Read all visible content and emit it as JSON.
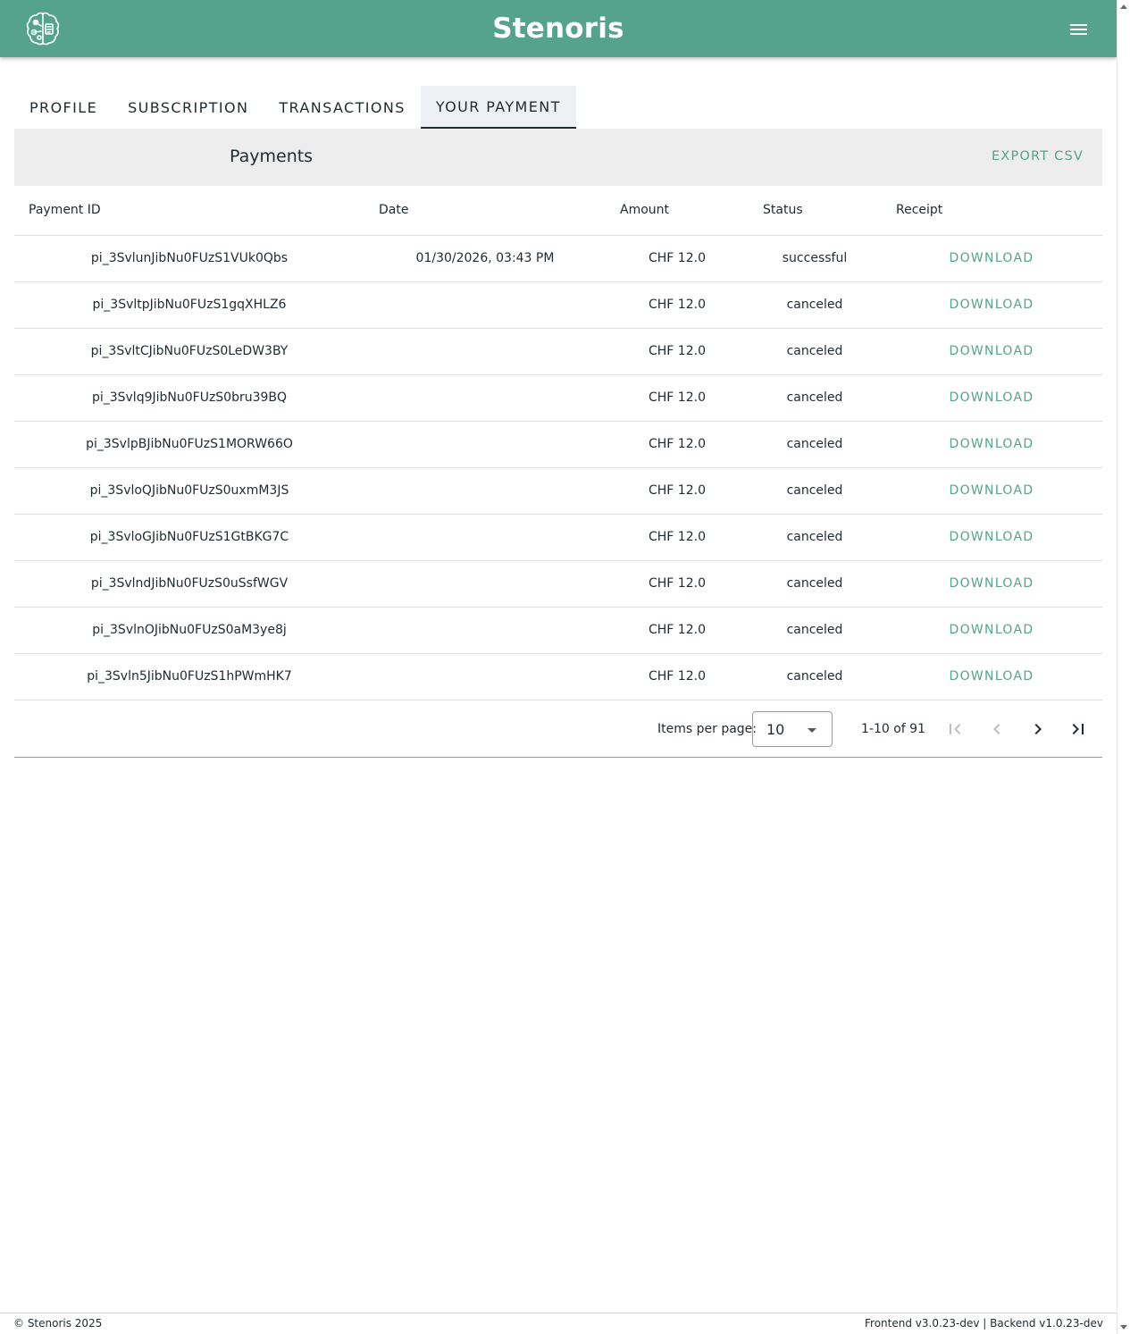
{
  "header": {
    "title": "Stenoris",
    "logo_icon": "brain-circuit-logo-icon",
    "menu_icon": "hamburger-menu-icon",
    "color": "#54a38a"
  },
  "tabs": [
    {
      "label": "PROFILE",
      "active": false
    },
    {
      "label": "SUBSCRIPTION",
      "active": false
    },
    {
      "label": "TRANSACTIONS",
      "active": false
    },
    {
      "label": "YOUR PAYMENT",
      "active": true
    }
  ],
  "payments": {
    "title": "Payments",
    "export_label": "EXPORT CSV",
    "columns": [
      "Payment ID",
      "Date",
      "Amount",
      "Status",
      "Receipt"
    ],
    "rows": [
      {
        "id": "pi_3SvlunJibNu0FUzS1VUk0Qbs",
        "date": "01/30/2026, 03:43 PM",
        "amount": "CHF 12.0",
        "status": "successful",
        "receipt": "DOWNLOAD"
      },
      {
        "id": "pi_3SvltpJibNu0FUzS1gqXHLZ6",
        "date": "",
        "amount": "CHF 12.0",
        "status": "canceled",
        "receipt": "DOWNLOAD"
      },
      {
        "id": "pi_3SvltCJibNu0FUzS0LeDW3BY",
        "date": "",
        "amount": "CHF 12.0",
        "status": "canceled",
        "receipt": "DOWNLOAD"
      },
      {
        "id": "pi_3Svlq9JibNu0FUzS0bru39BQ",
        "date": "",
        "amount": "CHF 12.0",
        "status": "canceled",
        "receipt": "DOWNLOAD"
      },
      {
        "id": "pi_3SvlpBJibNu0FUzS1MORW66O",
        "date": "",
        "amount": "CHF 12.0",
        "status": "canceled",
        "receipt": "DOWNLOAD"
      },
      {
        "id": "pi_3SvloQJibNu0FUzS0uxmM3JS",
        "date": "",
        "amount": "CHF 12.0",
        "status": "canceled",
        "receipt": "DOWNLOAD"
      },
      {
        "id": "pi_3SvloGJibNu0FUzS1GtBKG7C",
        "date": "",
        "amount": "CHF 12.0",
        "status": "canceled",
        "receipt": "DOWNLOAD"
      },
      {
        "id": "pi_3SvlndJibNu0FUzS0uSsfWGV",
        "date": "",
        "amount": "CHF 12.0",
        "status": "canceled",
        "receipt": "DOWNLOAD"
      },
      {
        "id": "pi_3SvlnOJibNu0FUzS0aM3ye8j",
        "date": "",
        "amount": "CHF 12.0",
        "status": "canceled",
        "receipt": "DOWNLOAD"
      },
      {
        "id": "pi_3Svln5JibNu0FUzS1hPWmHK7",
        "date": "",
        "amount": "CHF 12.0",
        "status": "canceled",
        "receipt": "DOWNLOAD"
      }
    ]
  },
  "paginator": {
    "items_per_page_label": "Items per page:",
    "items_per_page_value": "10",
    "range_label": "1-10 of 91",
    "icons": [
      "first-page-icon",
      "previous-page-icon",
      "next-page-icon",
      "last-page-icon"
    ]
  },
  "footer": {
    "copyright": "© Stenoris 2025",
    "versions": "Frontend v3.0.23-dev | Backend v1.0.23-dev"
  }
}
